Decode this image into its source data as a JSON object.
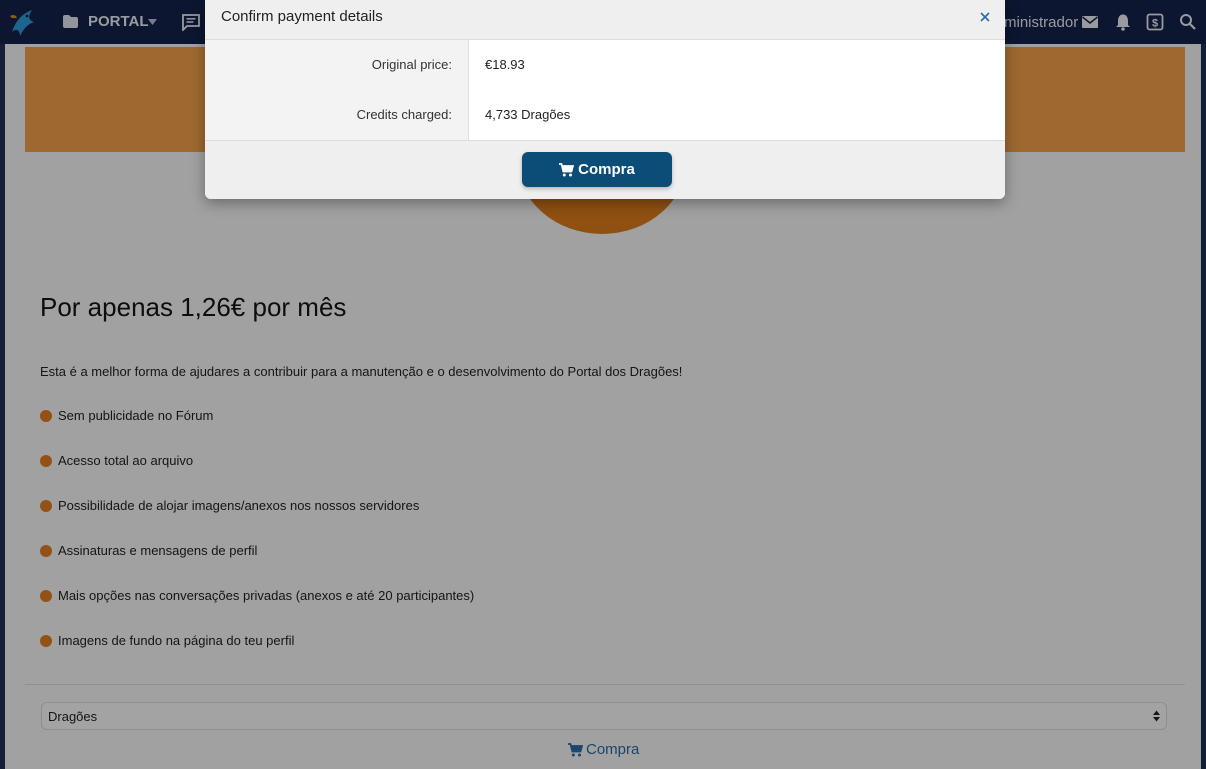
{
  "navbar": {
    "portal_label": "PORTAL",
    "user_label": "ministrador"
  },
  "modal": {
    "title": "Confirm payment details",
    "rows": [
      {
        "label": "Original price:",
        "value": "€18.93"
      },
      {
        "label": "Credits charged:",
        "value": "4,733 Dragões"
      }
    ],
    "button_label": "Compra"
  },
  "page": {
    "title": "Por apenas 1,26€ por mês",
    "intro": "Esta é a melhor forma de ajudares a contribuir para a manutenção e o desenvolvimento do Portal dos Dragões!",
    "features": [
      "Sem publicidade no Fórum",
      "Acesso total ao arquivo",
      "Possibilidade de alojar imagens/anexos nos nossos servidores",
      "Assinaturas e mensagens de perfil",
      "Mais opções nas conversações privadas (anexos e até 20 participantes)",
      "Imagens de fundo na página do teu perfil"
    ],
    "currency_select": "Dragões",
    "buy_link": "Compra"
  },
  "colors": {
    "navbar": "#15224a",
    "banner": "#f0a04b",
    "accent_orange": "#e07b22",
    "button_blue": "#0c4d78",
    "link_blue": "#2a6aa6"
  }
}
